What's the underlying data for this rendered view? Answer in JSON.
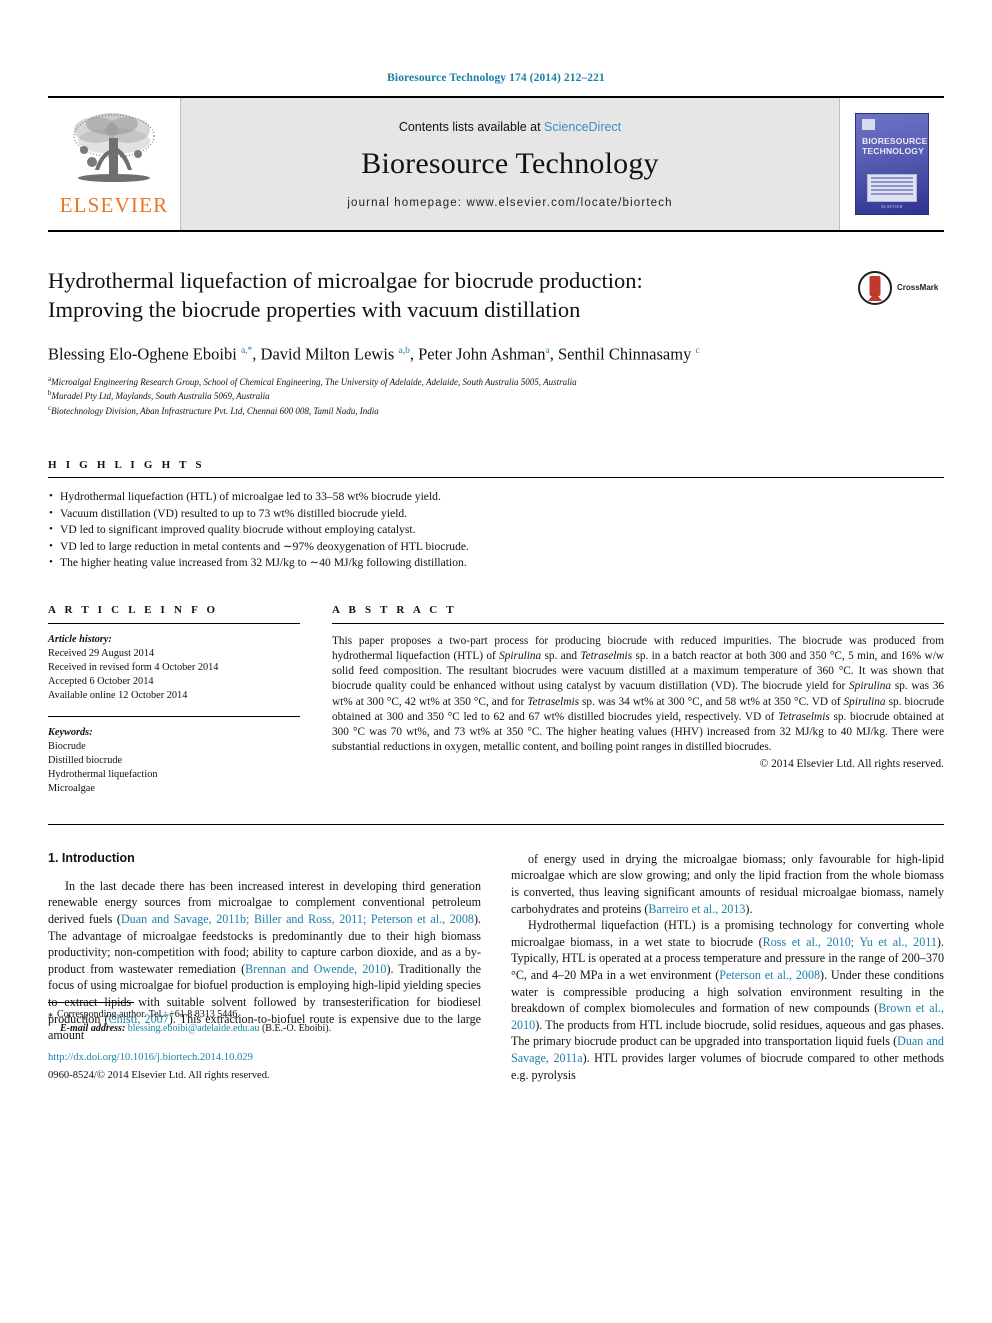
{
  "running_head": "Bioresource Technology 174 (2014) 212–221",
  "masthead": {
    "publisher_name": "ELSEVIER",
    "publisher_logo": "elsevier-tree-logo",
    "contents_prefix": "Contents lists available at ",
    "contents_link": "ScienceDirect",
    "journal_name": "Bioresource Technology",
    "homepage": "journal homepage: www.elsevier.com/locate/biortech",
    "cover": {
      "title_line1": "BIORESOURCE",
      "title_line2": "TECHNOLOGY",
      "footer": "ELSEVIER"
    }
  },
  "article": {
    "title_line1": "Hydrothermal liquefaction of microalgae for biocrude production:",
    "title_line2": "Improving the biocrude properties with vacuum distillation",
    "crossmark_label": "CrossMark",
    "authors_html": "Blessing Elo-Oghene Eboibi <sup class=\"star\">a,*</sup>, David Milton Lewis <sup>a,b</sup>, Peter John Ashman<sup>a</sup>, Senthil Chinnasamy <sup>c</sup>",
    "affiliations": [
      {
        "mark": "a",
        "text": "Microalgal Engineering Research Group, School of Chemical Engineering, The University of Adelaide, Adelaide, South Australia 5005, Australia"
      },
      {
        "mark": "b",
        "text": "Muradel Pty Ltd, Maylands, South Australia 5069, Australia"
      },
      {
        "mark": "c",
        "text": "Biotechnology Division, Aban Infrastructure Pvt. Ltd, Chennai 600 008, Tamil Nadu, India"
      }
    ]
  },
  "highlights": {
    "heading": "H I G H L I G H T S",
    "items": [
      "Hydrothermal liquefaction (HTL) of microalgae led to 33–58 wt% biocrude yield.",
      "Vacuum distillation (VD) resulted to up to 73 wt% distilled biocrude yield.",
      "VD led to significant improved quality biocrude without employing catalyst.",
      "VD led to large reduction in metal contents and ∼97% deoxygenation of HTL biocrude.",
      "The higher heating value increased from 32 MJ/kg to ∼40 MJ/kg following distillation."
    ]
  },
  "article_info": {
    "heading": "A R T I C L E  I N F O",
    "history_label": "Article history:",
    "history": [
      "Received 29 August 2014",
      "Received in revised form 4 October 2014",
      "Accepted 6 October 2014",
      "Available online 12 October 2014"
    ],
    "keywords_label": "Keywords:",
    "keywords": [
      "Biocrude",
      "Distilled biocrude",
      "Hydrothermal liquefaction",
      "Microalgae"
    ]
  },
  "abstract": {
    "heading": "A B S T R A C T",
    "body_html": "This paper proposes a two-part process for producing biocrude with reduced impurities. The biocrude was produced from hydrothermal liquefaction (HTL) of <i>Spirulina</i> sp. and <i>Tetraselmis</i> sp. in a batch reactor at both 300 and 350 °C, 5 min, and 16% w/w solid feed composition. The resultant biocrudes were vacuum distilled at a maximum temperature of 360 °C. It was shown that biocrude quality could be enhanced without using catalyst by vacuum distillation (VD). The biocrude yield for <i>Spirulina</i> sp. was 36 wt% at 300 °C, 42 wt% at 350 °C, and for <i>Tetraselmis</i> sp. was 34 wt% at 300 °C, and 58 wt% at 350 °C. VD of <i>Spirulina</i> sp. biocrude obtained at 300 and 350 °C led to 62 and 67 wt% distilled biocrudes yield, respectively. VD of <i>Tetraselmis</i> sp. biocrude obtained at 300 °C was 70 wt%, and 73 wt% at 350 °C. The higher heating values (HHV) increased from 32 MJ/kg to 40 MJ/kg. There were substantial reductions in oxygen, metallic content, and boiling point ranges in distilled biocrudes.",
    "copyright": "© 2014 Elsevier Ltd. All rights reserved."
  },
  "introduction": {
    "section_number_title": "1. Introduction",
    "left_paragraph_html": "In the last decade there has been increased interest in developing third generation renewable energy sources from microalgae to complement conventional petroleum derived fuels (<span class=\"cite\">Duan and Savage, 2011b; Biller and Ross, 2011; Peterson et al., 2008</span>). The advantage of microalgae feedstocks is predominantly due to their high biomass productivity; non-competition with food; ability to capture carbon dioxide, and as a by-product from wastewater remediation (<span class=\"cite\">Brennan and Owende, 2010</span>). Traditionally the focus of using microalgae for biofuel production is employing high-lipid yielding species to extract lipids with suitable solvent followed by transesterification for biodiesel production (<span class=\"cite\">Chisti, 2007</span>). This extraction-to-biofuel route is expensive due to the large amount",
    "right_paragraph1_html": "of energy used in drying the microalgae biomass; only favourable for high-lipid microalgae which are slow growing; and only the lipid fraction from the whole biomass is converted, thus leaving significant amounts of residual microalgae biomass, namely carbohydrates and proteins (<span class=\"cite\">Barreiro et al., 2013</span>).",
    "right_paragraph2_html": "Hydrothermal liquefaction (HTL) is a promising technology for converting whole microalgae biomass, in a wet state to biocrude (<span class=\"cite\">Ross et al., 2010; Yu et al., 2011</span>). Typically, HTL is operated at a process temperature and pressure in the range of 200–370 °C, and 4–20 MPa in a wet environment (<span class=\"cite\">Peterson et al., 2008</span>). Under these conditions water is compressible producing a high solvation environment resulting in the breakdown of complex biomolecules and formation of new compounds (<span class=\"cite\">Brown et al., 2010</span>). The products from HTL include biocrude, solid residues, aqueous and gas phases. The primary biocrude product can be upgraded into transportation liquid fuels (<span class=\"cite\">Duan and Savage, 2011a</span>). HTL provides larger volumes of biocrude compared to other methods e.g. pyrolysis"
  },
  "footnotes": {
    "corresponding_star": "⁎",
    "corresponding_text": "Corresponding author. Tel.: +61 8 8313 5446.",
    "email_label": "E-mail address:",
    "email": "blessing.eboibi@adelaide.edu.au",
    "email_suffix": "(B.E.-O. Eboibi).",
    "doi_url": "http://dx.doi.org/10.1016/j.biortech.2014.10.029",
    "issn_line": "0960-8524/© 2014 Elsevier Ltd. All rights reserved."
  },
  "colors": {
    "link": "#1a7fa8",
    "elsevier_orange": "#E87722",
    "masthead_gray": "#e6e6e6"
  }
}
